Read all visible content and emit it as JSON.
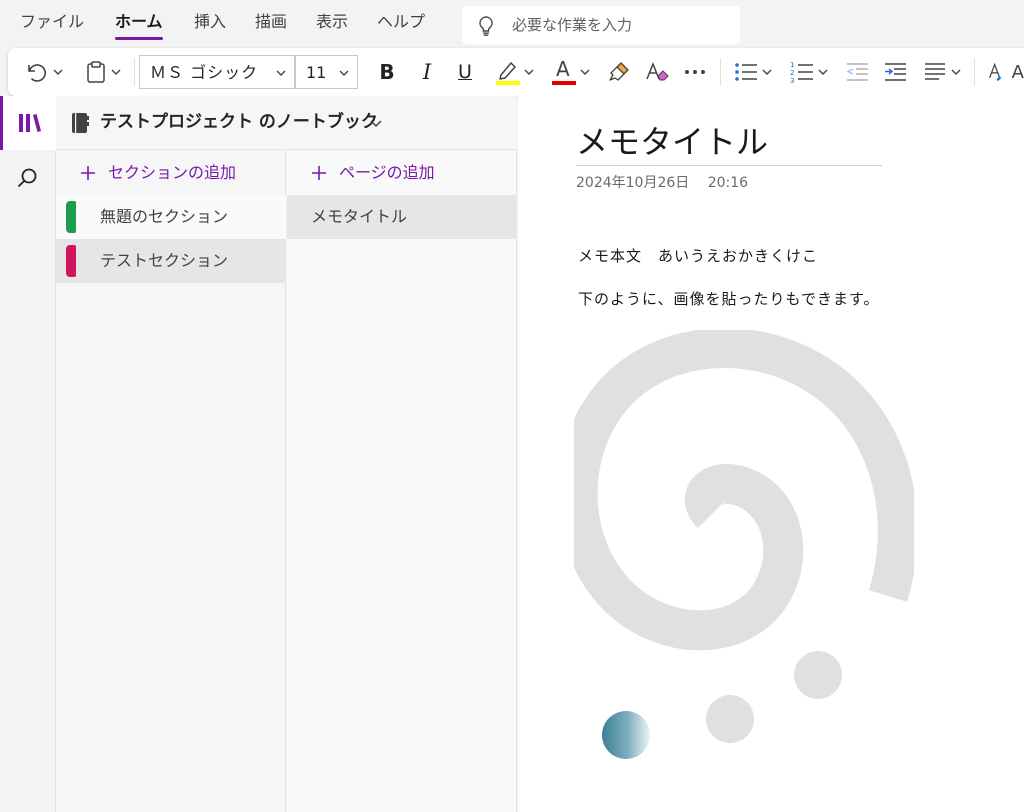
{
  "menu": {
    "items": [
      "ファイル",
      "ホーム",
      "挿入",
      "描画",
      "表示",
      "ヘルプ"
    ],
    "active": "ホーム",
    "tell_me_placeholder": "必要な作業を入力"
  },
  "ribbon": {
    "font_name": "ＭＳ ゴシック",
    "font_size": "11",
    "bold_label": "B",
    "italic_label": "I",
    "underline_label": "U",
    "font_color_label": "A",
    "highlight_color": "#ffff00",
    "font_color": "#e00000",
    "partial_label": "A"
  },
  "notebook": {
    "name": "テストプロジェクト のノートブック"
  },
  "sections": {
    "add_label": "セクションの追加",
    "items": [
      {
        "label": "無題のセクション",
        "color": "#1e9c52"
      },
      {
        "label": "テストセクション",
        "color": "#d0155f"
      }
    ]
  },
  "pages": {
    "add_label": "ページの追加",
    "items": [
      {
        "label": "メモタイトル"
      }
    ]
  },
  "note": {
    "title": "メモタイトル",
    "date": "2024年10月26日",
    "time": "20:16",
    "lines": [
      "メモ本文　あいうえおかきくけこ",
      "下のように、画像を貼ったりもできます。"
    ]
  },
  "colors": {
    "accent": "#7719aa",
    "spiral": "#e0e0e0"
  }
}
